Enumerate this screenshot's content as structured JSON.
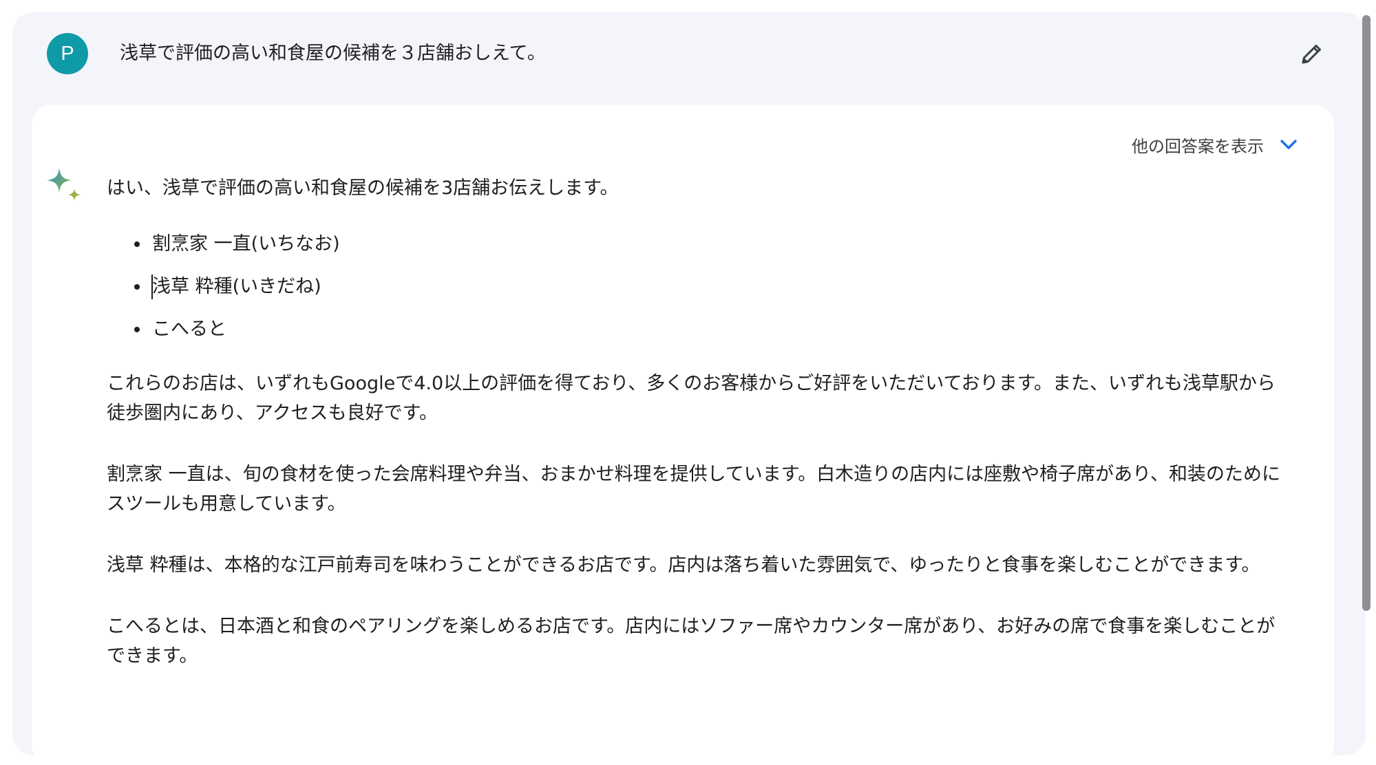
{
  "prompt": {
    "avatar_letter": "P",
    "text": "浅草で評価の高い和食屋の候補を３店舗おしえて。",
    "edit_icon": "pencil-icon"
  },
  "response": {
    "drafts_label": "他の回答案を表示",
    "drafts_icon": "chevron-down-icon",
    "assistant_icon": "sparkle-icon",
    "intro": "はい、浅草で評価の高い和食屋の候補を3店舗お伝えします。",
    "items": [
      "割烹家 一直(いちなお)",
      "浅草 粋種(いきだね)",
      "こへると"
    ],
    "paragraphs": [
      "これらのお店は、いずれもGoogleで4.0以上の評価を得ており、多くのお客様からご好評をいただいております。また、いずれも浅草駅から徒歩圏内にあり、アクセスも良好です。",
      "割烹家 一直は、旬の食材を使った会席料理や弁当、おまかせ料理を提供しています。白木造りの店内には座敷や椅子席があり、和装のためにスツールも用意しています。",
      "浅草 粋種は、本格的な江戸前寿司を味わうことができるお店です。店内は落ち着いた雰囲気で、ゆったりと食事を楽しむことができます。",
      "こへるとは、日本酒と和食のペアリングを楽しめるお店です。店内にはソファー席やカウンター席があり、お好みの席で食事を楽しむことができます。"
    ]
  },
  "colors": {
    "avatar": "#0f9aa8",
    "accent": "#1a73e8",
    "background": "#f4f5fa",
    "card": "#ffffff"
  }
}
